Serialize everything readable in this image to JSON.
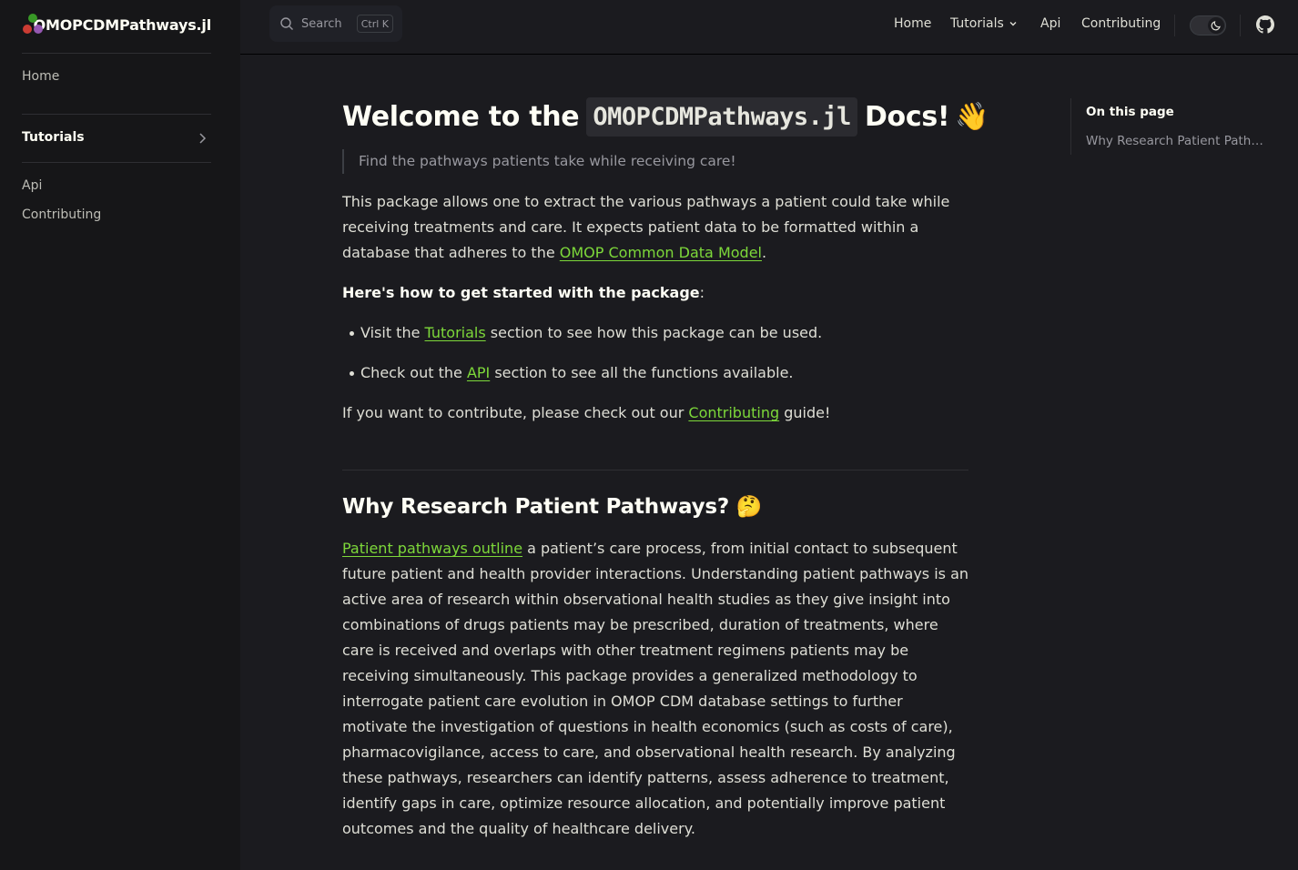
{
  "sidebar": {
    "brand_title": "OMOPCDMPathways.jl",
    "items": [
      {
        "label": "Home"
      },
      {
        "label": "Tutorials"
      },
      {
        "label": "Api"
      },
      {
        "label": "Contributing"
      }
    ]
  },
  "topbar": {
    "search_label": "Search",
    "search_kbd": "Ctrl K",
    "nav": [
      {
        "label": "Home"
      },
      {
        "label": "Tutorials"
      },
      {
        "label": "Api"
      },
      {
        "label": "Contributing"
      }
    ]
  },
  "main": {
    "title_prefix": "Welcome to the",
    "title_code": "OMOPCDMPathways.jl",
    "title_suffix": "Docs!",
    "title_emoji": "👋",
    "tagline": "Find the pathways patients take while receiving care!",
    "intro_text": "This package allows one to extract the various pathways a patient could take while receiving treatments and care. It expects patient data to be formatted within a database that adheres to the ",
    "intro_link": "OMOP Common Data Model",
    "intro_end": ".",
    "getting_started_bold": "Here's how to get started with the package",
    "getting_started_colon": ":",
    "bullets": [
      {
        "pre": "Visit the ",
        "link": "Tutorials",
        "post": " section to see how this package can be used."
      },
      {
        "pre": "Check out the ",
        "link": "API",
        "post": " section to see all the functions available."
      }
    ],
    "contribute_pre": "If you want to contribute, please check out our ",
    "contribute_link": "Contributing",
    "contribute_post": " guide!",
    "section_title": "Why Research Patient Pathways?",
    "section_emoji": "🤔",
    "section_link": "Patient pathways outline",
    "section_text": " a patient’s care process, from initial contact to subsequent future patient and health provider interactions. Understanding patient pathways is an active area of research within observational health studies as they give insight into combinations of drugs patients may be prescribed, duration of treatments, where care is received and overlaps with other treatment regimens patients may be receiving simultaneously. This package provides a generalized methodology to interrogate patient care evolution in OMOP CDM database settings to further motivate the investigation of questions in health economics (such as costs of care), pharmacovigilance, access to care, and observational health research. By analyzing these pathways, researchers can identify patterns, assess adherence to treatment, identify gaps in care, optimize resource allocation, and potentially improve patient outcomes and the quality of healthcare delivery."
  },
  "outline": {
    "title": "On this page",
    "items": [
      {
        "label": "Why Research Patient Pathways?"
      }
    ]
  },
  "colors": {
    "background": "#1b1b1f",
    "sidebar": "#161618",
    "link": "#7dd83a",
    "text": "#dfdfd6"
  }
}
